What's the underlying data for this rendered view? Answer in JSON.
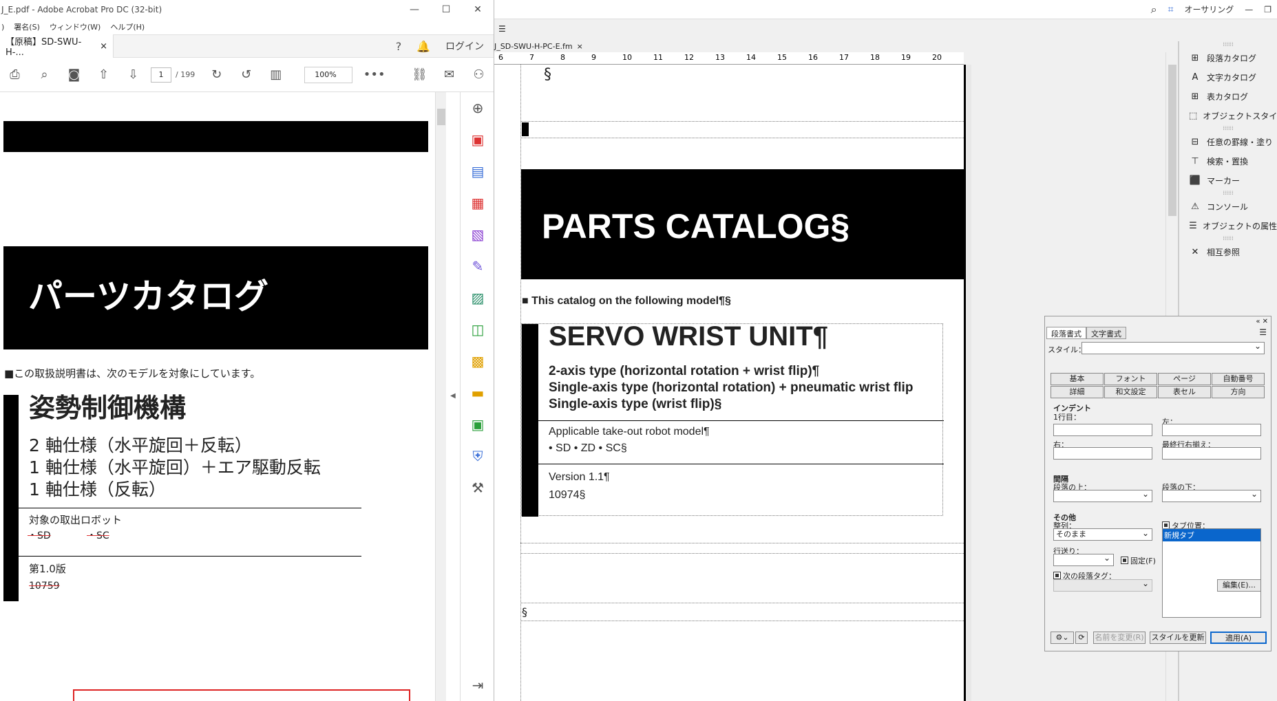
{
  "acrobat": {
    "title": "J_E.pdf - Adobe Acrobat Pro DC (32-bit)",
    "menu": [
      ")",
      "署名(S)",
      "ウィンドウ(W)",
      "ヘルプ(H)"
    ],
    "tab_label": "【原稿】SD-SWU-H-...",
    "tab_close": "×",
    "help": "?",
    "login": "ログイン",
    "page_current": "1",
    "page_total": "/ 199",
    "zoom": "100%",
    "more": "•••",
    "doc": {
      "heading": "パーツカタログ",
      "model_line": "■この取扱説明書は、次のモデルを対象にしています。",
      "product": "姿勢制御機構",
      "lines": [
        "2 軸仕様（水平旋回＋反転）",
        "1 軸仕様（水平旋回）＋エア駆動反転",
        "1 軸仕様（反転）"
      ],
      "robot_label": "対象の取出ロボット",
      "robot_sd": "・SD",
      "robot_sc": "・SC",
      "version": "第1.0版",
      "doc_number": "10759"
    }
  },
  "framemaker": {
    "top_item": "オーサリング",
    "doc_tab": "J_SD-SWU-H-PC-E.fm",
    "doc_tab_close": "×",
    "ruler": [
      "6",
      "7",
      "8",
      "9",
      "10",
      "11",
      "12",
      "13",
      "14",
      "15",
      "16",
      "17",
      "18",
      "19",
      "20"
    ],
    "section_mark": "§",
    "title": "PARTS CATALOG§",
    "model_line": "■ This catalog on the following model¶§",
    "product": "SERVO WRIST UNIT¶",
    "types": [
      "2-axis type (horizontal rotation + wrist flip)¶",
      "Single-axis type (horizontal rotation) + pneumatic wrist flip",
      "Single-axis type (wrist flip)§"
    ],
    "robot_label": "Applicable take-out robot model¶",
    "robot_models": "• SD   • ZD   • SC§",
    "version": "Version 1.1¶",
    "doc_number": "10974§",
    "panel": [
      {
        "icon": "paragraph-catalog-icon",
        "glyph": "⊞",
        "label": "段落カタログ"
      },
      {
        "icon": "character-catalog-icon",
        "glyph": "A",
        "label": "文字カタログ"
      },
      {
        "icon": "table-catalog-icon",
        "glyph": "⊞",
        "label": "表カタログ"
      },
      {
        "icon": "object-style-icon",
        "glyph": "⬚",
        "label": "オブジェクトスタイルカタ"
      },
      {
        "icon": "rule-fill-icon",
        "glyph": "⊟",
        "label": "任意の罫線・塗り"
      },
      {
        "icon": "find-replace-icon",
        "glyph": "⊤",
        "label": "検索・置換"
      },
      {
        "icon": "marker-icon",
        "glyph": "⬛",
        "label": "マーカー"
      },
      {
        "icon": "console-icon",
        "glyph": "⚠",
        "label": "コンソール"
      },
      {
        "icon": "object-properties-icon",
        "glyph": "☰",
        "label": "オブジェクトの属性"
      },
      {
        "icon": "cross-reference-icon",
        "glyph": "✕",
        "label": "相互参照"
      }
    ]
  },
  "para_designer": {
    "tabs": [
      "段落書式",
      "文字書式"
    ],
    "style_label": "スタイル：",
    "buttons_row1": [
      "基本",
      "フォント",
      "ページ",
      "自動番号"
    ],
    "buttons_row2": [
      "詳細",
      "和文設定",
      "表セル",
      "方向"
    ],
    "indent_group": "インデント",
    "first_line": "1行目：",
    "left": "左：",
    "right": "右：",
    "last_line_right": "最終行右揃え：",
    "spacing_group": "間隔",
    "above": "段落の上：",
    "below": "段落の下：",
    "other_group": "その他",
    "align": "整列：",
    "align_value": "そのまま",
    "tab_stops": "タブ位置：",
    "tab_new": "新規タブ",
    "line_spacing": "行送り：",
    "fixed": "固定(F)",
    "next_tag": "次の段落タグ：",
    "edit_btn": "編集(E)...",
    "rename_btn": "名前を変更(R)",
    "update_btn": "スタイルを更新",
    "apply_btn": "適用(A)"
  }
}
